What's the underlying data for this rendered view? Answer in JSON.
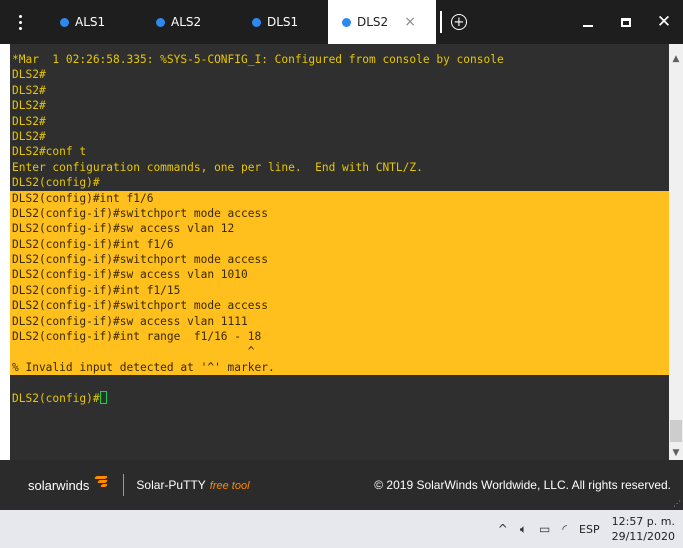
{
  "tabs": [
    {
      "label": "ALS1",
      "active": false
    },
    {
      "label": "ALS2",
      "active": false
    },
    {
      "label": "DLS1",
      "active": false
    },
    {
      "label": "DLS2",
      "active": true
    }
  ],
  "new_tab_symbol": "+",
  "tab_close_symbol": "×",
  "window_close_symbol": "✕",
  "colors": {
    "tab_dot": "#2d89ef",
    "terminal_bg": "#2f2f2f",
    "terminal_text": "#e6c700",
    "highlight_bg": "#ffbf1c",
    "cursor": "#18d04f",
    "brand_accent": "#ff8a00"
  },
  "terminal": {
    "lines": [
      {
        "text": "*Mar  1 02:26:58.335: %SYS-5-CONFIG_I: Configured from console by console",
        "highlight": false
      },
      {
        "text": "DLS2#",
        "highlight": false
      },
      {
        "text": "DLS2#",
        "highlight": false
      },
      {
        "text": "DLS2#",
        "highlight": false
      },
      {
        "text": "DLS2#",
        "highlight": false
      },
      {
        "text": "DLS2#",
        "highlight": false
      },
      {
        "text": "DLS2#conf t",
        "highlight": false
      },
      {
        "text": "Enter configuration commands, one per line.  End with CNTL/Z.",
        "highlight": false
      },
      {
        "text": "DLS2(config)#",
        "highlight": false
      },
      {
        "text": "DLS2(config)#int f1/6",
        "highlight": true
      },
      {
        "text": "DLS2(config-if)#switchport mode access",
        "highlight": true
      },
      {
        "text": "DLS2(config-if)#sw access vlan 12",
        "highlight": true
      },
      {
        "text": "DLS2(config-if)#int f1/6",
        "highlight": true
      },
      {
        "text": "DLS2(config-if)#switchport mode access",
        "highlight": true
      },
      {
        "text": "DLS2(config-if)#sw access vlan 1010",
        "highlight": true
      },
      {
        "text": "DLS2(config-if)#int f1/15",
        "highlight": true
      },
      {
        "text": "DLS2(config-if)#switchport mode access",
        "highlight": true
      },
      {
        "text": "DLS2(config-if)#sw access vlan 1111",
        "highlight": true
      },
      {
        "text": "DLS2(config-if)#int range  f1/16 - 18",
        "highlight": true
      },
      {
        "text": "                                   ^",
        "highlight": true
      },
      {
        "text": "% Invalid input detected at '^' marker.",
        "highlight": true
      },
      {
        "text": "",
        "highlight": false
      }
    ],
    "prompt": "DLS2(config)#"
  },
  "footer": {
    "brand": "solarwinds",
    "product": "Solar-PuTTY",
    "product_tag": "free tool",
    "copyright": "© 2019 SolarWinds Worldwide, LLC. All rights reserved."
  },
  "taskbar": {
    "tray_chevron": "^",
    "language": "ESP",
    "time": "12:57 p. m.",
    "date": "29/11/2020"
  }
}
